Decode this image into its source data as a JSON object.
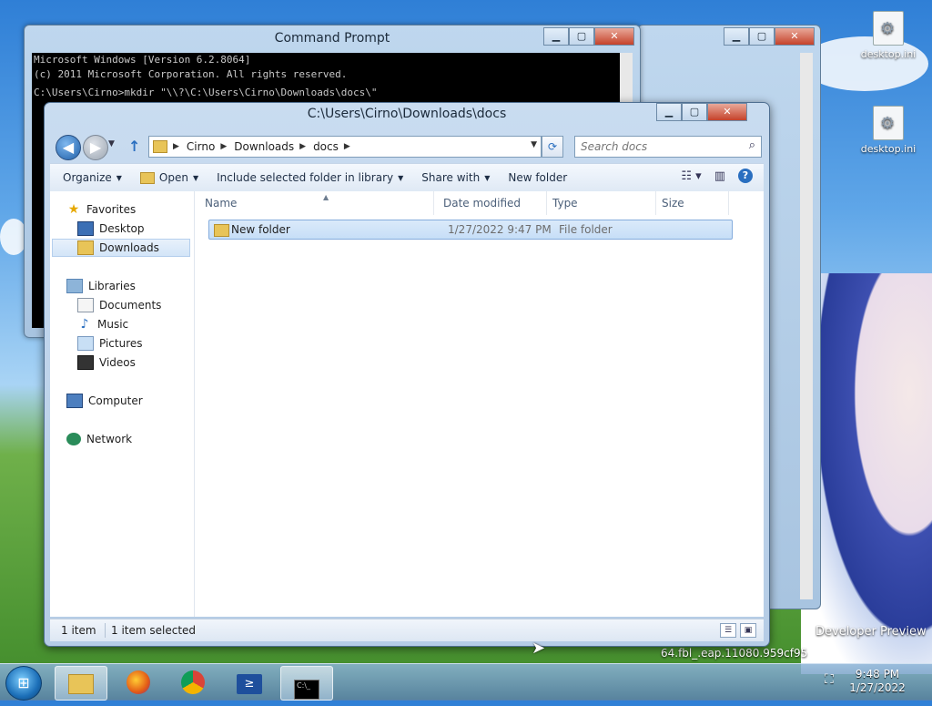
{
  "cmd_window": {
    "title": "Command Prompt",
    "lines": [
      "Microsoft Windows [Version 6.2.8064]",
      "(c) 2011 Microsoft Corporation. All rights reserved.",
      "",
      "C:\\Users\\Cirno>mkdir \"\\\\?\\C:\\Users\\Cirno\\Downloads\\docs\\\""
    ]
  },
  "desktop": {
    "icons": [
      {
        "label": "desktop.ini"
      },
      {
        "label": "desktop.ini"
      }
    ],
    "behind_text": {
      "developer": "Developer Preview",
      "build": "64.fbl_.eap.11080.959cf95"
    }
  },
  "explorer": {
    "title": "C:\\Users\\Cirno\\Downloads\\docs",
    "breadcrumb": [
      "Cirno",
      "Downloads",
      "docs"
    ],
    "search_placeholder": "Search docs",
    "toolbar": {
      "organize": "Organize",
      "open": "Open",
      "include": "Include selected folder in library",
      "share": "Share with",
      "new_folder": "New folder"
    },
    "nav": {
      "favorites": "Favorites",
      "desktop": "Desktop",
      "downloads": "Downloads",
      "libraries": "Libraries",
      "documents": "Documents",
      "music": "Music",
      "pictures": "Pictures",
      "videos": "Videos",
      "computer": "Computer",
      "network": "Network"
    },
    "columns": {
      "name": "Name",
      "date": "Date modified",
      "type": "Type",
      "size": "Size"
    },
    "rows": [
      {
        "name": "New folder",
        "date": "1/27/2022 9:47 PM",
        "type": "File folder",
        "size": ""
      }
    ],
    "status": {
      "count": "1 item",
      "selected": "1 item selected"
    }
  },
  "taskbar": {
    "time": "9:48 PM",
    "date": "1/27/2022"
  }
}
